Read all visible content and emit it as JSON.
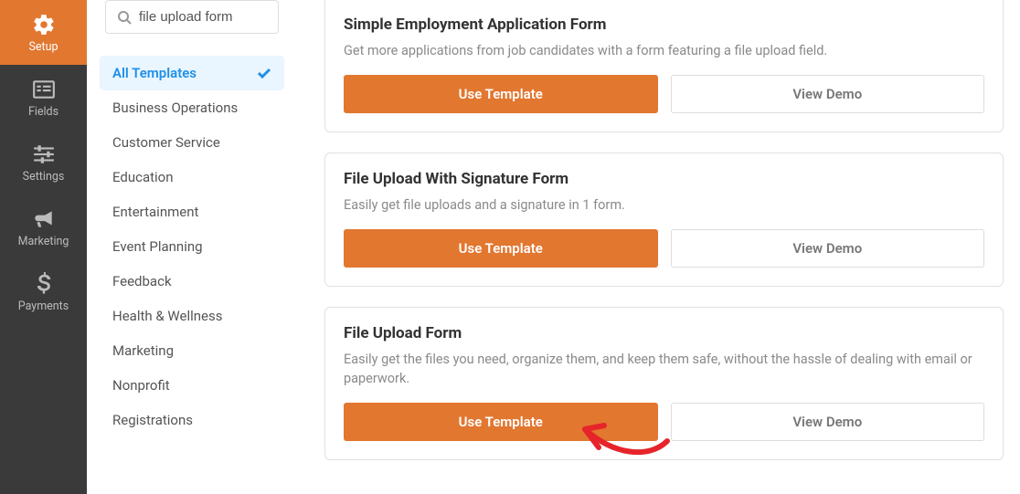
{
  "sidenav": {
    "items": [
      {
        "label": "Setup",
        "icon": "gear"
      },
      {
        "label": "Fields",
        "icon": "list"
      },
      {
        "label": "Settings",
        "icon": "sliders"
      },
      {
        "label": "Marketing",
        "icon": "bullhorn"
      },
      {
        "label": "Payments",
        "icon": "dollar"
      }
    ]
  },
  "search": {
    "value": "file upload form"
  },
  "categories": [
    "All Templates",
    "Business Operations",
    "Customer Service",
    "Education",
    "Entertainment",
    "Event Planning",
    "Feedback",
    "Health & Wellness",
    "Marketing",
    "Nonprofit",
    "Registrations"
  ],
  "templates": [
    {
      "title": "Simple Employment Application Form",
      "desc": "Get more applications from job candidates with a form featuring a file upload field.",
      "use_label": "Use Template",
      "demo_label": "View Demo"
    },
    {
      "title": "File Upload With Signature Form",
      "desc": "Easily get file uploads and a signature in 1 form.",
      "use_label": "Use Template",
      "demo_label": "View Demo"
    },
    {
      "title": "File Upload Form",
      "desc": "Easily get the files you need, organize them, and keep them safe, without the hassle of dealing with email or paperwork.",
      "use_label": "Use Template",
      "demo_label": "View Demo"
    }
  ]
}
